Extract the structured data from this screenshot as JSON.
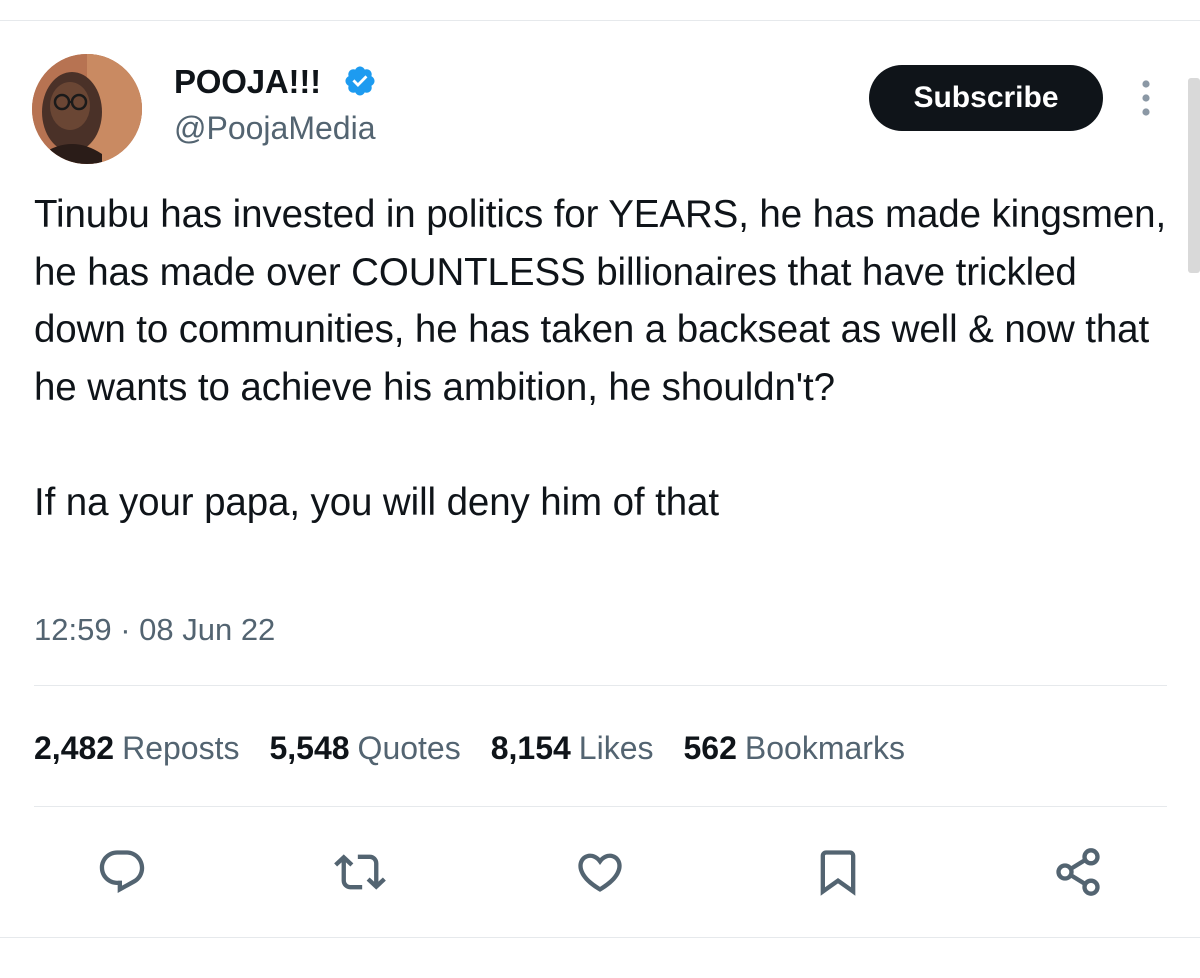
{
  "author": {
    "display_name": "POOJA!!!",
    "handle": "@PoojaMedia",
    "verified": true,
    "verified_color": "#1d9bf0"
  },
  "subscribe_label": "Subscribe",
  "tweet": {
    "text": "Tinubu has invested in politics for YEARS, he has made kingsmen, he has made over COUNTLESS billionaires that have trickled down to communities, he has taken a backseat as well & now that he wants to achieve his ambition, he shouldn't?\n\nIf na your papa, you will deny him of that",
    "timestamp": "12:59 · 08 Jun 22"
  },
  "stats": [
    {
      "count": "2,482",
      "label": "Reposts"
    },
    {
      "count": "5,548",
      "label": "Quotes"
    },
    {
      "count": "8,154",
      "label": "Likes"
    },
    {
      "count": "562",
      "label": "Bookmarks"
    }
  ],
  "actions": [
    "reply-icon",
    "repost-icon",
    "like-icon",
    "bookmark-icon",
    "share-icon"
  ],
  "colors": {
    "text": "#0f1419",
    "secondary": "#536471",
    "divider": "#e6e9ec",
    "button_bg": "#0f1419"
  }
}
